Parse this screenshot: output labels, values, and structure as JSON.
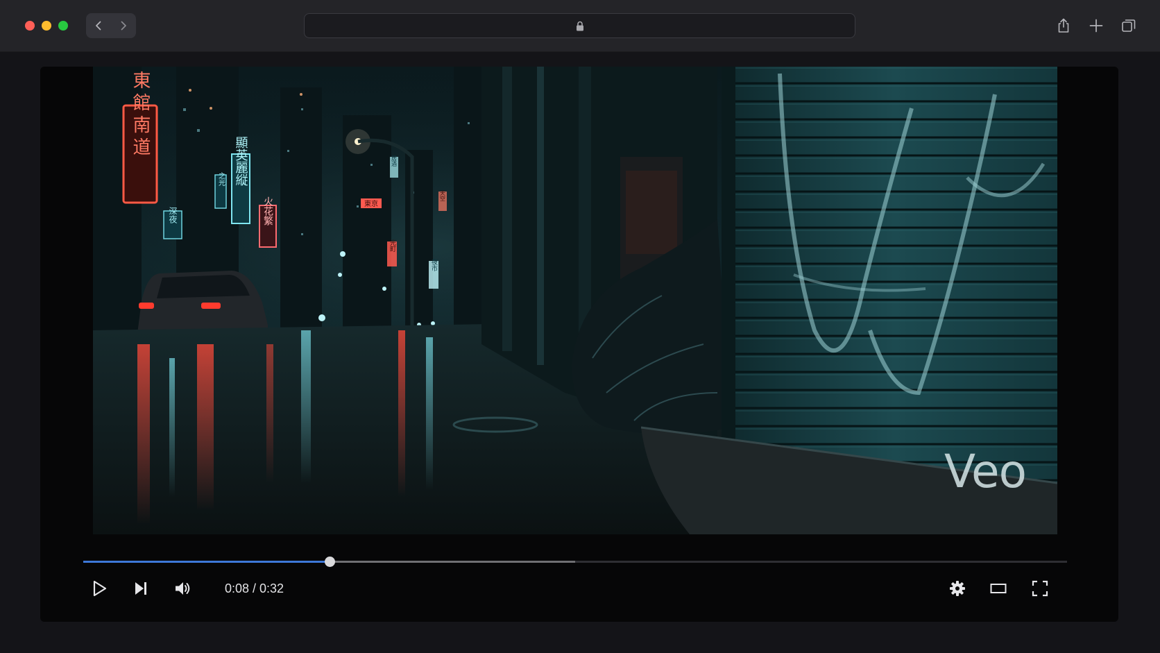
{
  "colors": {
    "accent": "#3d78d8",
    "traffic_red": "#ff5f57",
    "traffic_yellow": "#febc2e",
    "traffic_green": "#28c840"
  },
  "browser": {
    "address_icon": "lock-icon",
    "back_icon": "chevron-left-icon",
    "forward_icon": "chevron-right-icon",
    "toolbar_icons": [
      "share-icon",
      "new-tab-plus-icon",
      "tab-overview-icon"
    ]
  },
  "player": {
    "watermark": "Veo",
    "time_display": "0:08 / 0:32",
    "progress": {
      "played_fraction": 0.25,
      "buffered_fraction": 0.5
    },
    "controls_left": [
      "play-icon",
      "next-icon",
      "volume-icon"
    ],
    "controls_right": [
      "settings-gear-icon",
      "theater-mode-icon",
      "fullscreen-icon"
    ],
    "signs": {
      "sign1": "東館南道",
      "sign2": "顯英麗縦",
      "sign3": "火花繁",
      "sign4": "深夜",
      "sign5": "之光",
      "sign6": "東京",
      "sign7": "光町",
      "sign8": "夜市",
      "sign9": "居酒",
      "sign10": "天空"
    }
  }
}
